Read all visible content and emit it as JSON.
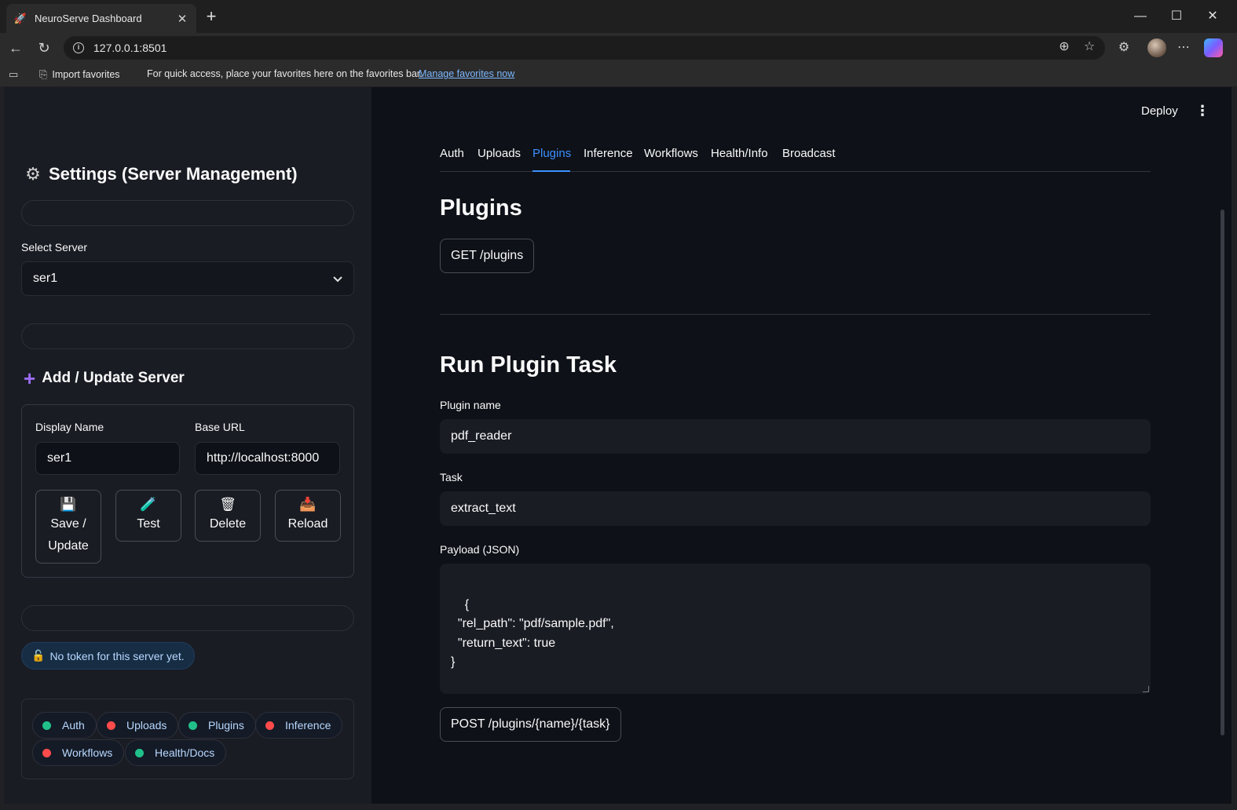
{
  "browser": {
    "tab_title": "NeuroServe Dashboard",
    "url": "127.0.0.1:8501",
    "favbar": {
      "import_label": "Import favorites",
      "hint": "For quick access, place your favorites here on the favorites bar.",
      "manage_link": "Manage favorites now"
    }
  },
  "sidebar": {
    "title": "Settings (Server Management)",
    "select_label": "Select Server",
    "select_value": "ser1",
    "add_title": "Add / Update Server",
    "display_name_label": "Display Name",
    "display_name_value": "ser1",
    "base_url_label": "Base URL",
    "base_url_value": "http://localhost:8000",
    "buttons": {
      "save_line1": "Save /",
      "save_line2": "Update",
      "test": "Test",
      "delete": "Delete",
      "reload": "Reload"
    },
    "token_status": "No token for this server yet.",
    "status_chips": [
      {
        "label": "Auth",
        "status": "ok"
      },
      {
        "label": "Uploads",
        "status": "down"
      },
      {
        "label": "Plugins",
        "status": "ok"
      },
      {
        "label": "Inference",
        "status": "down"
      },
      {
        "label": "Workflows",
        "status": "down"
      },
      {
        "label": "Health/Docs",
        "status": "ok"
      }
    ]
  },
  "header": {
    "deploy": "Deploy"
  },
  "tabs": [
    "Auth",
    "Uploads",
    "Plugins",
    "Inference",
    "Workflows",
    "Health/Info",
    "Broadcast"
  ],
  "active_tab": "Plugins",
  "main": {
    "plugins_title": "Plugins",
    "get_button": "GET /plugins",
    "run_title": "Run Plugin Task",
    "plugin_name_label": "Plugin name",
    "plugin_name_value": "pdf_reader",
    "task_label": "Task",
    "task_value": "extract_text",
    "payload_label": "Payload (JSON)",
    "payload_value": "{\n  \"rel_path\": \"pdf/sample.pdf\",\n  \"return_text\": true\n}",
    "post_button": "POST /plugins/{name}/{task}"
  },
  "colors": {
    "ok": "#21c08b",
    "down": "#ff4b4b",
    "accent": "#3c8fff"
  }
}
